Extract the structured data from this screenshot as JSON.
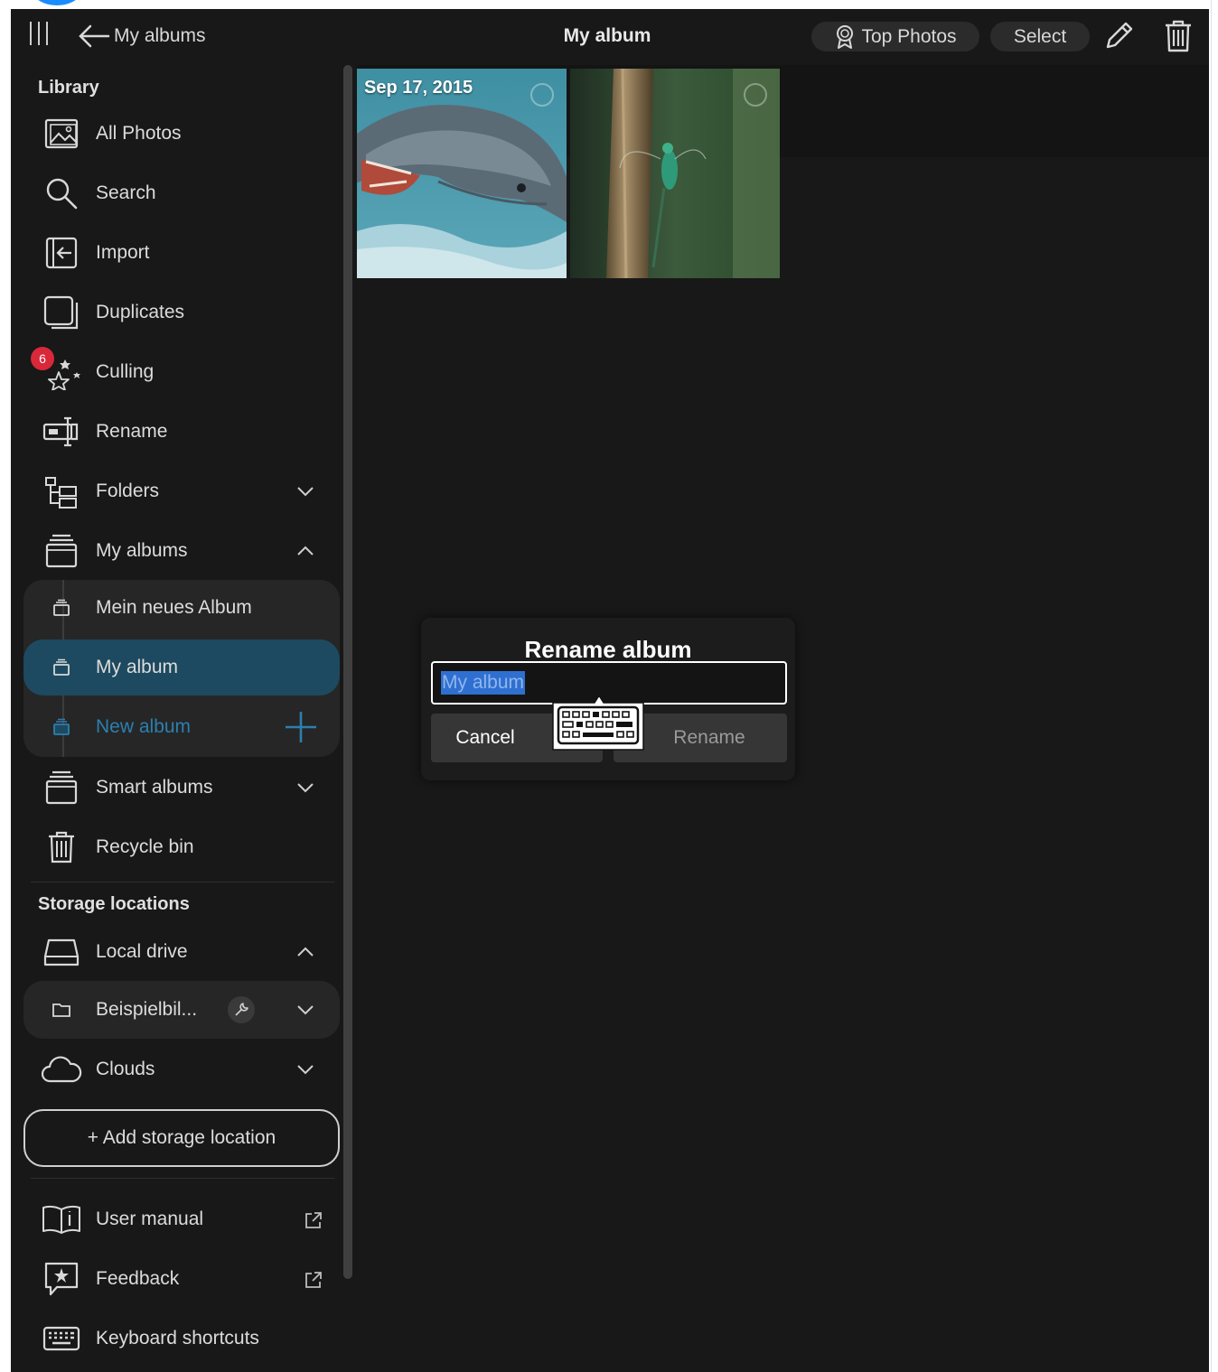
{
  "header": {
    "back_label": "My albums",
    "title": "My album",
    "top_photos_label": "Top Photos",
    "select_label": "Select"
  },
  "sidebar": {
    "library_title": "Library",
    "items": [
      {
        "label": "All Photos",
        "icon": "photos-icon"
      },
      {
        "label": "Search",
        "icon": "search-icon"
      },
      {
        "label": "Import",
        "icon": "import-icon"
      },
      {
        "label": "Duplicates",
        "icon": "duplicates-icon"
      },
      {
        "label": "Culling",
        "icon": "culling-stars-icon",
        "badge": "6"
      },
      {
        "label": "Rename",
        "icon": "rename-icon"
      },
      {
        "label": "Folders",
        "icon": "folders-icon"
      },
      {
        "label": "My albums",
        "icon": "album-icon"
      }
    ],
    "albums": [
      {
        "label": "Mein neues Album"
      },
      {
        "label": "My album",
        "active": true
      },
      {
        "label": "New album"
      }
    ],
    "more_items": [
      {
        "label": "Smart albums",
        "icon": "smart-album-icon"
      },
      {
        "label": "Recycle bin",
        "icon": "trash-icon"
      }
    ],
    "storage_title": "Storage locations",
    "storage": {
      "local_drive": "Local drive",
      "folder": "Beispielbil...",
      "clouds": "Clouds"
    },
    "add_storage_label": "+ Add storage location",
    "footer_items": [
      {
        "label": "User manual",
        "icon": "manual-icon"
      },
      {
        "label": "Feedback",
        "icon": "feedback-icon"
      },
      {
        "label": "Keyboard shortcuts",
        "icon": "keyboard-icon"
      }
    ]
  },
  "photos": [
    {
      "date": "Sep 17, 2015",
      "subject": "dolphin"
    },
    {
      "date": "",
      "subject": "damselfly"
    }
  ],
  "dialog": {
    "title": "Rename album",
    "input_value": "My album",
    "cancel_label": "Cancel",
    "rename_label": "Rename"
  },
  "colors": {
    "background": "#181818",
    "active_item": "#1d4a60",
    "accent": "#2c7fb0",
    "badge": "#d8283a"
  }
}
